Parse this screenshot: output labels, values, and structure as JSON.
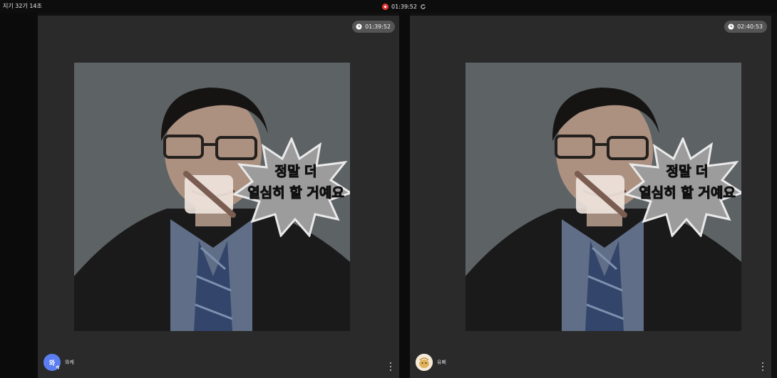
{
  "header": {
    "room_title": "지기 32기 14조",
    "recording_time": "01:39:52"
  },
  "tiles": [
    {
      "timer": "01:39:52",
      "caption_line1": "정말 더",
      "caption_line2": "열심히 할 거예요",
      "participant_name": "와케",
      "avatar_initial": "와",
      "avatar_badge": "케"
    },
    {
      "timer": "02:40:53",
      "caption_line1": "정말 더",
      "caption_line2": "열심히 할 거예요",
      "participant_name": "유삐"
    }
  ],
  "colors": {
    "record": "#e53935",
    "avatar_blue": "#5b7ff2",
    "tile_bg": "#2a2a2a"
  }
}
